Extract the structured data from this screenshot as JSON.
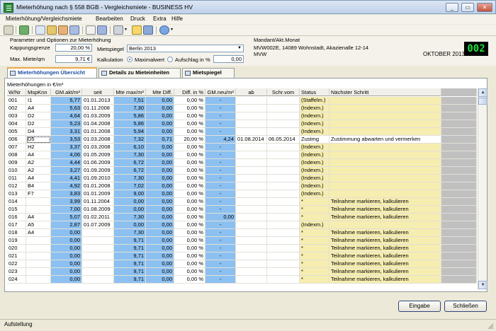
{
  "window": {
    "title": "Mieterhöhung nach § 558 BGB - Vergleichsmiete - BUSINESS HV",
    "minimize": "_",
    "maximize": "▭",
    "close": "✕"
  },
  "menu": [
    "Mieterhöhung/Vergleichsmiete",
    "Bearbeiten",
    "Druck",
    "Extra",
    "Hilfe"
  ],
  "params": {
    "section_title": "Parameter und Optionen zur Mieterhöhung",
    "kappung_label": "Kappungsgrenze",
    "kappung_value": "20,00 %",
    "max_miete_label": "Max. Miete/qm",
    "max_miete_value": "9,71 €",
    "mietspiegel_label": "Mietspiegel",
    "mietspiegel_value": "Berlin 2013",
    "kalkulation_label": "Kalkulation",
    "opt_maximalwert": "Maximalwert",
    "opt_aufschlag": "Aufschlag in %",
    "aufschlag_value": "0,00"
  },
  "mandant": {
    "label": "Mandant/Akt.Monat",
    "line1": "MVW002E, 14089 Wohnstadt, Akazienalle 12-14",
    "line2": "MVW",
    "month": "OKTOBER 2013",
    "number": "002"
  },
  "tabs": [
    "Mieterhöhungen Übersicht",
    "Details zu Mieteinheiten",
    "Mietspiegel"
  ],
  "grid": {
    "caption": "Mieterhöhungen in €/m²",
    "headers": [
      "W/Nr",
      "MspKnn",
      "GM.akt/m²",
      "seit",
      "Mte max/m²",
      "Mte Diff.",
      "Diff. in %",
      "GM.neu/m²",
      "ab",
      "Schr.vom",
      "Status",
      "Nächster Schritt"
    ],
    "rows": [
      [
        "001",
        "I1",
        "5,77",
        "01.01.2013",
        "7,51",
        "0,00",
        "0,00 %",
        "-",
        "",
        "",
        "(Staffelm.)",
        ""
      ],
      [
        "002",
        "A4",
        "5,63",
        "01.11.2008",
        "7,30",
        "0,00",
        "0,00 %",
        "-",
        "",
        "",
        "(Indexm.)",
        ""
      ],
      [
        "003",
        "D2",
        "4,64",
        "01.03.2009",
        "5,86",
        "0,00",
        "0,00 %",
        "-",
        "",
        "",
        "(Indexm.)",
        ""
      ],
      [
        "004",
        "D2",
        "5,23",
        "01.04.2008",
        "5,86",
        "0,00",
        "0,00 %",
        "-",
        "",
        "",
        "(Indexm.)",
        ""
      ],
      [
        "005",
        "D4",
        "3,31",
        "01.01.2008",
        "5,94",
        "0,00",
        "0,00 %",
        "-",
        "",
        "",
        "(Indexm.)",
        ""
      ],
      [
        "006",
        "D5",
        "3,53",
        "01.03.2008",
        "7,32",
        "0,71",
        "20,00 %",
        "4,24",
        "01.08.2014",
        "06.05.2014",
        "Zustmg",
        "Zustimmung abwarten und vermerken"
      ],
      [
        "007",
        "H2",
        "3,37",
        "01.03.2008",
        "6,10",
        "0,00",
        "0,00 %",
        "-",
        "",
        "",
        "(Indexm.)",
        ""
      ],
      [
        "008",
        "A4",
        "4,06",
        "01.05.2009",
        "7,30",
        "0,00",
        "0,00 %",
        "-",
        "",
        "",
        "(Indexm.)",
        ""
      ],
      [
        "009",
        "A2",
        "4,44",
        "01.06.2009",
        "6,72",
        "0,00",
        "0,00 %",
        "-",
        "",
        "",
        "(Indexm.)",
        ""
      ],
      [
        "010",
        "A2",
        "3,27",
        "01.09.2009",
        "6,72",
        "0,00",
        "0,00 %",
        "-",
        "",
        "",
        "(Indexm.)",
        ""
      ],
      [
        "011",
        "A4",
        "4,41",
        "01.09.2010",
        "7,30",
        "0,00",
        "0,00 %",
        "-",
        "",
        "",
        "(Indexm.)",
        ""
      ],
      [
        "012",
        "B4",
        "4,92",
        "01.01.2008",
        "7,02",
        "0,00",
        "0,00 %",
        "-",
        "",
        "",
        "(Indexm.)",
        ""
      ],
      [
        "013",
        "F7",
        "3,83",
        "01.01.2009",
        "9,00",
        "0,00",
        "0,00 %",
        "-",
        "",
        "",
        "(Indexm.)",
        ""
      ],
      [
        "014",
        "",
        "3,99",
        "01.11.2004",
        "0,00",
        "0,00",
        "0,00 %",
        "-",
        "",
        "",
        "*",
        "Teilnahme markieren, kalkulieren"
      ],
      [
        "015",
        "",
        "7,00",
        "01.08.2009",
        "0,00",
        "0,00",
        "0,00 %",
        "-",
        "",
        "",
        "*",
        "Teilnahme markieren, kalkulieren"
      ],
      [
        "016",
        "A4",
        "5,07",
        "01.02.2011",
        "7,30",
        "0,00",
        "0,00 %",
        "0,00",
        "",
        "",
        "*",
        "Teilnahme markieren, kalkulieren"
      ],
      [
        "017",
        "A5",
        "2,87",
        "01.07.2009",
        "0,00",
        "0,00",
        "0,00 %",
        "-",
        "",
        "",
        "(Indexm.)",
        ""
      ],
      [
        "018",
        "A4",
        "0,00",
        "",
        "7,30",
        "0,00",
        "0,00 %",
        "-",
        "",
        "",
        "*",
        "Teilnahme markieren, kalkulieren"
      ],
      [
        "019",
        "",
        "0,00",
        "",
        "9,71",
        "0,00",
        "0,00 %",
        "-",
        "",
        "",
        "*",
        "Teilnahme markieren, kalkulieren"
      ],
      [
        "020",
        "",
        "0,00",
        "",
        "9,71",
        "0,00",
        "0,00 %",
        "-",
        "",
        "",
        "*",
        "Teilnahme markieren, kalkulieren"
      ],
      [
        "021",
        "",
        "0,00",
        "",
        "9,71",
        "0,00",
        "0,00 %",
        "-",
        "",
        "",
        "*",
        "Teilnahme markieren, kalkulieren"
      ],
      [
        "022",
        "",
        "0,00",
        "",
        "9,71",
        "0,00",
        "0,00 %",
        "-",
        "",
        "",
        "*",
        "Teilnahme markieren, kalkulieren"
      ],
      [
        "023",
        "",
        "0,00",
        "",
        "9,71",
        "0,00",
        "0,00 %",
        "-",
        "",
        "",
        "*",
        "Teilnahme markieren, kalkulieren"
      ],
      [
        "024",
        "",
        "0,00",
        "",
        "9,71",
        "0,00",
        "0,00 %",
        "-",
        "",
        "",
        "*",
        "Teilnahme markieren, kalkulieren"
      ]
    ]
  },
  "buttons": {
    "eingabe": "Eingabe",
    "schliessen": "Schließen"
  },
  "status_text": "Aufstellung",
  "colors": {
    "accent_blue": "#8cc0f0",
    "status_yellow": "#f6edb0",
    "badge_green": "#19e03a"
  },
  "icons": [
    "settings-icon",
    "flag-icon",
    "document-icon",
    "calculator-icon",
    "print-icon",
    "folder-icon",
    "help-icon"
  ]
}
